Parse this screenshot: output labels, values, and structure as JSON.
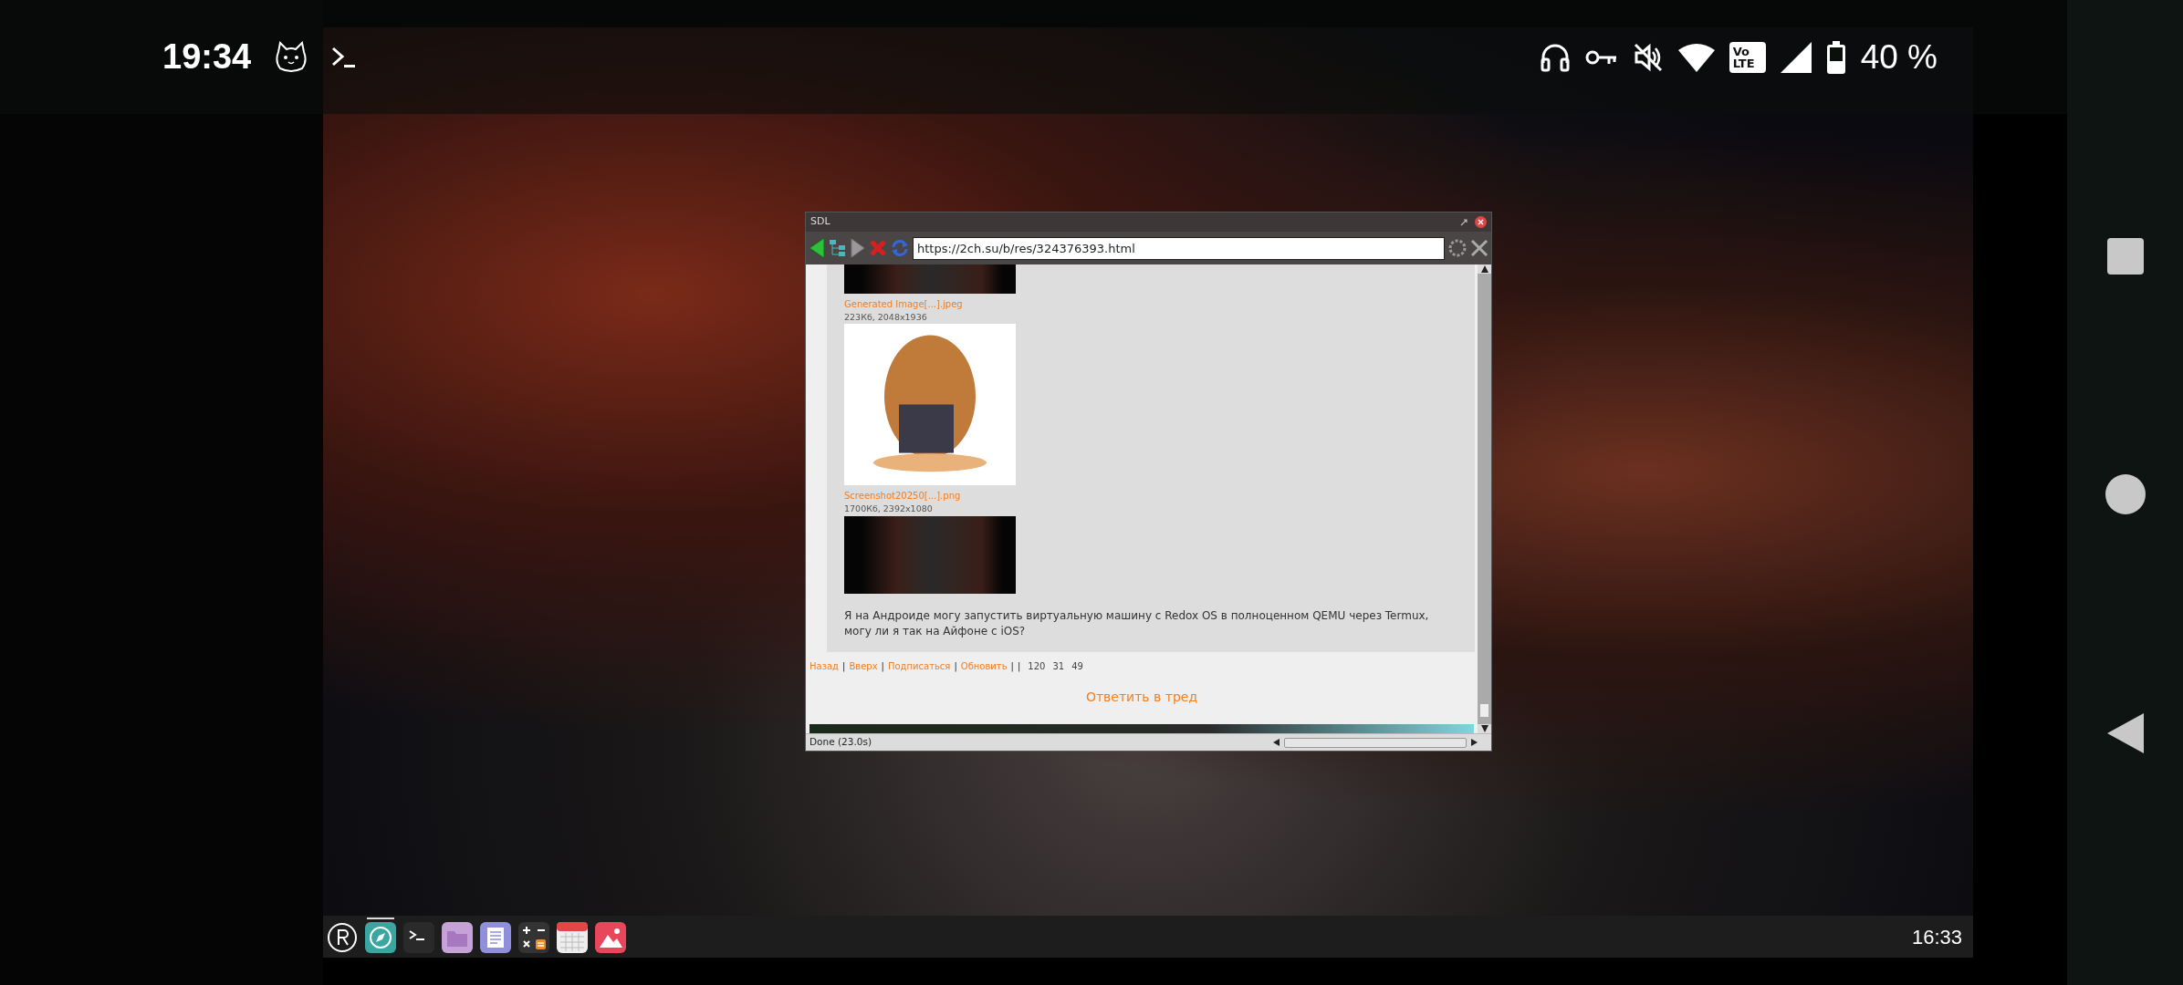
{
  "status_bar": {
    "time": "19:34",
    "volte_lines": [
      "Vo",
      "LTE"
    ],
    "battery": "40 %"
  },
  "window": {
    "title": "SDL",
    "url": "https://2ch.su/b/res/324376393.html",
    "top_image": {
      "kind": "dark"
    },
    "attachments": [
      {
        "name": "Generated Image[...].jpeg",
        "info": "223Кб, 2048x1936",
        "kind": "light"
      },
      {
        "name": "Screenshot20250[...].png",
        "info": "1700Кб, 2392x1080",
        "kind": "dark"
      }
    ],
    "post_text": "Я на Андроиде могу запустить виртуальную машину с Redox OS в полноценном QEMU через Termux, могу ли я так на Айфоне с iOS?",
    "footer_items": [
      {
        "kind": "link",
        "text": "Назад"
      },
      {
        "kind": "separator",
        "text": "|"
      },
      {
        "kind": "link",
        "text": "Вверх"
      },
      {
        "kind": "separator",
        "text": "|"
      },
      {
        "kind": "link",
        "text": "Подписаться"
      },
      {
        "kind": "separator",
        "text": "|"
      },
      {
        "kind": "link",
        "text": "Обновить"
      },
      {
        "kind": "separator",
        "text": "|"
      },
      {
        "kind": "separator",
        "text": "|"
      },
      {
        "kind": "count",
        "text": "120"
      },
      {
        "kind": "count",
        "text": "31"
      },
      {
        "kind": "count",
        "text": "49"
      }
    ],
    "reply_link": "Ответить в тред",
    "status": "Done (23.0s)"
  },
  "taskbar": {
    "apps": [
      {
        "kind": "redox",
        "running": false
      },
      {
        "kind": "browser",
        "running": true
      },
      {
        "kind": "terminal",
        "running": false
      },
      {
        "kind": "files",
        "running": false
      },
      {
        "kind": "editor",
        "running": false
      },
      {
        "kind": "calculator",
        "running": false
      },
      {
        "kind": "calendar",
        "running": false
      },
      {
        "kind": "image",
        "running": false
      }
    ],
    "clock": "16:33"
  }
}
